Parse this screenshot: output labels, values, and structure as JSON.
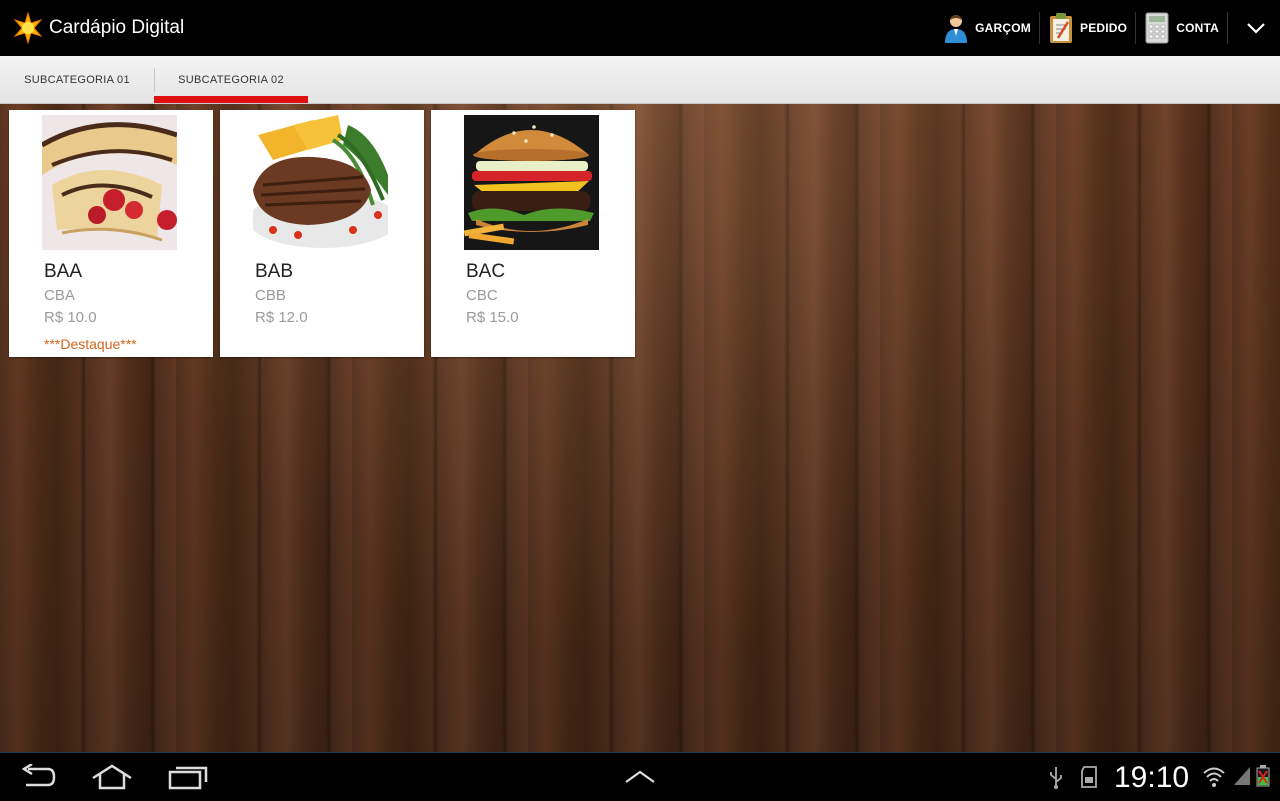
{
  "app": {
    "title": "Cardápio Digital"
  },
  "actions": {
    "waiter_label": "GARÇOM",
    "order_label": "PEDIDO",
    "bill_label": "CONTA"
  },
  "tabs": [
    {
      "label": "SUBCATEGORIA 01",
      "selected": false
    },
    {
      "label": "SUBCATEGORIA 02",
      "selected": true
    }
  ],
  "products": [
    {
      "name": "BAA",
      "description": "CBA",
      "price": "R$ 10.0",
      "highlight": "***Destaque***",
      "image": "crepe-photo"
    },
    {
      "name": "BAB",
      "description": "CBB",
      "price": "R$ 12.0",
      "highlight": "",
      "image": "steak-photo"
    },
    {
      "name": "BAC",
      "description": "CBC",
      "price": "R$ 15.0",
      "highlight": "",
      "image": "burger-photo"
    }
  ],
  "system": {
    "time": "19:10"
  },
  "colors": {
    "tab_indicator": "#e01010",
    "highlight_text": "#d4661b",
    "action_bar": "#000000"
  }
}
